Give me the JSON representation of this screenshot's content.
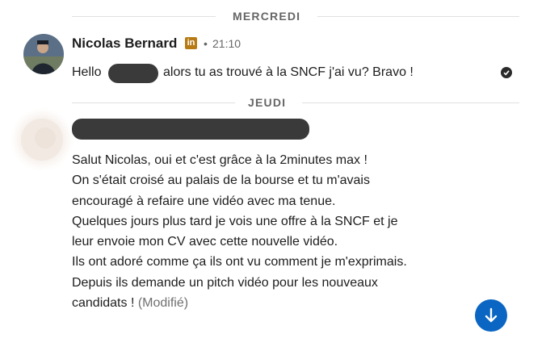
{
  "dividers": {
    "day1": "MERCREDI",
    "day2": "JEUDI"
  },
  "message1": {
    "sender": "Nicolas Bernard",
    "badge_letter": "in",
    "separator": "•",
    "time": "21:10",
    "text_before": "Hello",
    "text_after": "alors tu as trouvé à la SNCF j'ai vu? Bravo !"
  },
  "message2": {
    "lines": [
      "Salut Nicolas, oui  et c'est grâce à la 2minutes max !",
      "On s'était croisé au palais de la bourse et tu m'avais",
      "encouragé à refaire une vidéo avec ma tenue.",
      "Quelques jours plus tard je vois une offre à la SNCF et je",
      "leur envoie mon CV avec cette nouvelle vidéo.",
      "Ils ont adoré comme ça ils ont vu comment je m'exprimais.",
      "Depuis ils demande un pitch vidéo pour les nouveaux",
      "candidats !"
    ],
    "edited_label": "(Modifié)"
  },
  "icons": {
    "linkedin_badge": "linkedin-icon",
    "read_receipt": "check-circle-icon",
    "scroll_down": "arrow-down-icon"
  },
  "colors": {
    "accent": "#0a66c2",
    "linkedin_badge": "#b77a14"
  }
}
